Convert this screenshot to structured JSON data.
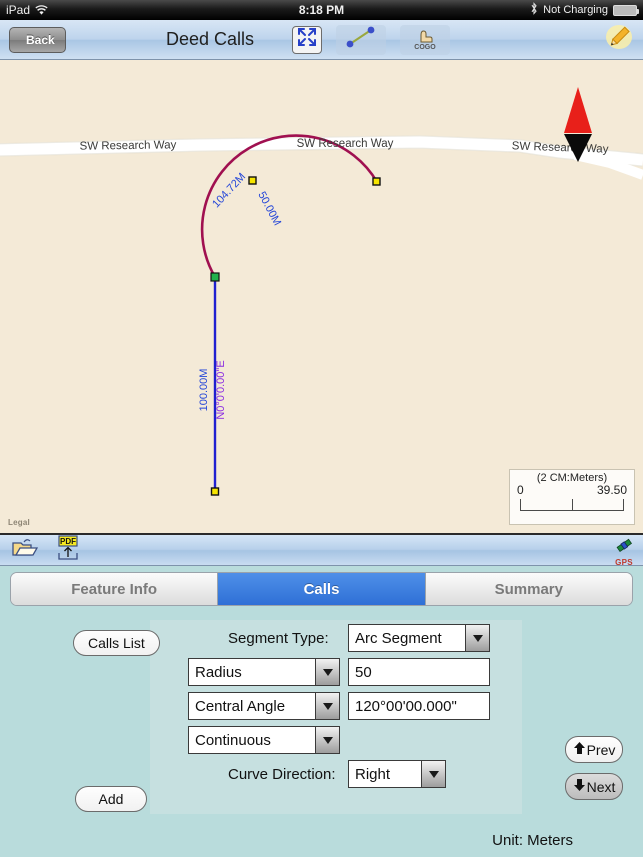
{
  "statusbar": {
    "device": "iPad",
    "wifi_icon": "wifi-icon",
    "time": "8:18 PM",
    "bluetooth_icon": "bluetooth-icon",
    "charge_state": "Not Charging",
    "battery_icon": "battery-icon"
  },
  "navbar": {
    "back_label": "Back",
    "title": "Deed Calls",
    "tools": [
      {
        "name": "fullscreen-icon",
        "label": ""
      },
      {
        "name": "line-segment-icon",
        "label": ""
      },
      {
        "name": "cogo-icon",
        "label": "COGO"
      }
    ],
    "edit_icon": "pencil-icon"
  },
  "map": {
    "background_color": "#f4ead7",
    "attribution": "Legal",
    "roads": [
      {
        "name": "SW Research Way"
      },
      {
        "name": "SW Research Way"
      },
      {
        "name": "SW Research Way"
      }
    ],
    "compass": {
      "name": "compass-needle",
      "north_color": "#e8201a",
      "south_color": "#0a0a0a"
    },
    "arc_labels": [
      {
        "text": "104.72M",
        "color": "#2446d8"
      },
      {
        "text": "50.00M",
        "color": "#2446d8"
      }
    ],
    "line_labels": [
      {
        "text": "100.00M",
        "color": "#2446d8"
      },
      {
        "text": "N0°0'0.00\"E",
        "color": "#8a2be2"
      }
    ],
    "arc_color": "#a01050",
    "line_color": "#2020d0",
    "scalebar": {
      "unit_caption": "(2 CM:Meters)",
      "min": "0",
      "max": "39.50"
    }
  },
  "panel": {
    "toolbar": {
      "open_icon": "open-folder-icon",
      "pdf_icon": "pdf-export-icon",
      "gps_icon": "gps-icon",
      "gps_label": "GPS"
    },
    "tabs": [
      {
        "label": "Feature Info",
        "active": false
      },
      {
        "label": "Calls",
        "active": true
      },
      {
        "label": "Summary",
        "active": false
      }
    ],
    "calls_list_label": "Calls List",
    "add_label": "Add",
    "segment_type_label": "Segment Type:",
    "segment_type_value": "Arc Segment",
    "param1_type": "Radius",
    "param1_value": "50",
    "param2_type": "Central Angle",
    "param2_value": "120°00'00.000\"",
    "param3_type": "Continuous",
    "curve_direction_label": "Curve Direction:",
    "curve_direction_value": "Right",
    "prev_label": "Prev",
    "next_label": "Next",
    "unit_text": "Unit:  Meters"
  }
}
